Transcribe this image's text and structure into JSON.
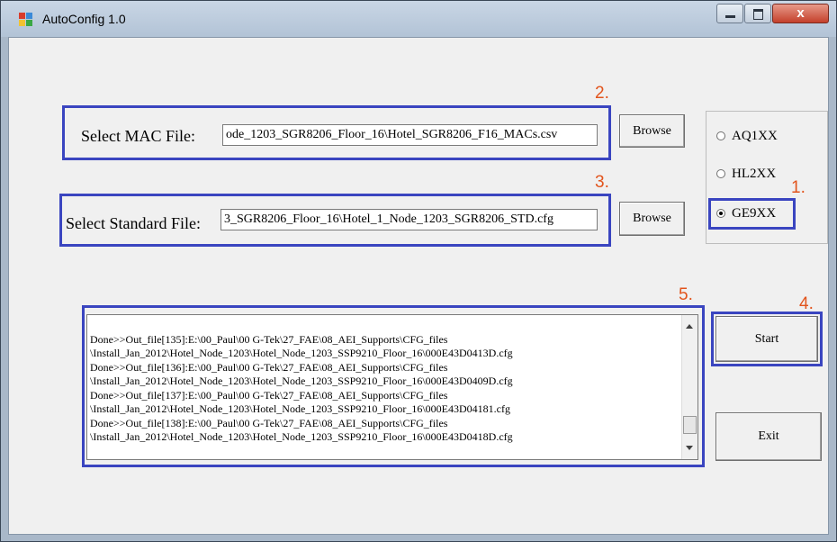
{
  "window": {
    "title": "AutoConfig 1.0",
    "close_glyph": "x"
  },
  "annotations": {
    "n1": "1.",
    "n2": "2.",
    "n3": "3.",
    "n4": "4.",
    "n5": "5.",
    "color": "#e2541c",
    "box_color": "#3a45c0"
  },
  "mac": {
    "label": "Select MAC File:",
    "value": "ode_1203_SGR8206_Floor_16\\Hotel_SGR8206_F16_MACs.csv",
    "browse": "Browse"
  },
  "standard": {
    "label": "Select Standard File:",
    "value": "3_SGR8206_Floor_16\\Hotel_1_Node_1203_SGR8206_STD.cfg",
    "browse": "Browse"
  },
  "models": [
    {
      "label": "AQ1XX",
      "selected": false
    },
    {
      "label": "HL2XX",
      "selected": false
    },
    {
      "label": "GE9XX",
      "selected": true
    }
  ],
  "log": {
    "lines": [
      "Done>>Out_file[135]:E:\\00_Paul\\00 G-Tek\\27_FAE\\08_AEI_Supports\\CFG_files",
      "\\Install_Jan_2012\\Hotel_Node_1203\\Hotel_Node_1203_SSP9210_Floor_16\\000E43D0413D.cfg",
      "Done>>Out_file[136]:E:\\00_Paul\\00 G-Tek\\27_FAE\\08_AEI_Supports\\CFG_files",
      "\\Install_Jan_2012\\Hotel_Node_1203\\Hotel_Node_1203_SSP9210_Floor_16\\000E43D0409D.cfg",
      "Done>>Out_file[137]:E:\\00_Paul\\00 G-Tek\\27_FAE\\08_AEI_Supports\\CFG_files",
      "\\Install_Jan_2012\\Hotel_Node_1203\\Hotel_Node_1203_SSP9210_Floor_16\\000E43D04181.cfg",
      "Done>>Out_file[138]:E:\\00_Paul\\00 G-Tek\\27_FAE\\08_AEI_Supports\\CFG_files",
      "\\Install_Jan_2012\\Hotel_Node_1203\\Hotel_Node_1203_SSP9210_Floor_16\\000E43D0418D.cfg"
    ]
  },
  "actions": {
    "start": "Start",
    "exit": "Exit"
  }
}
